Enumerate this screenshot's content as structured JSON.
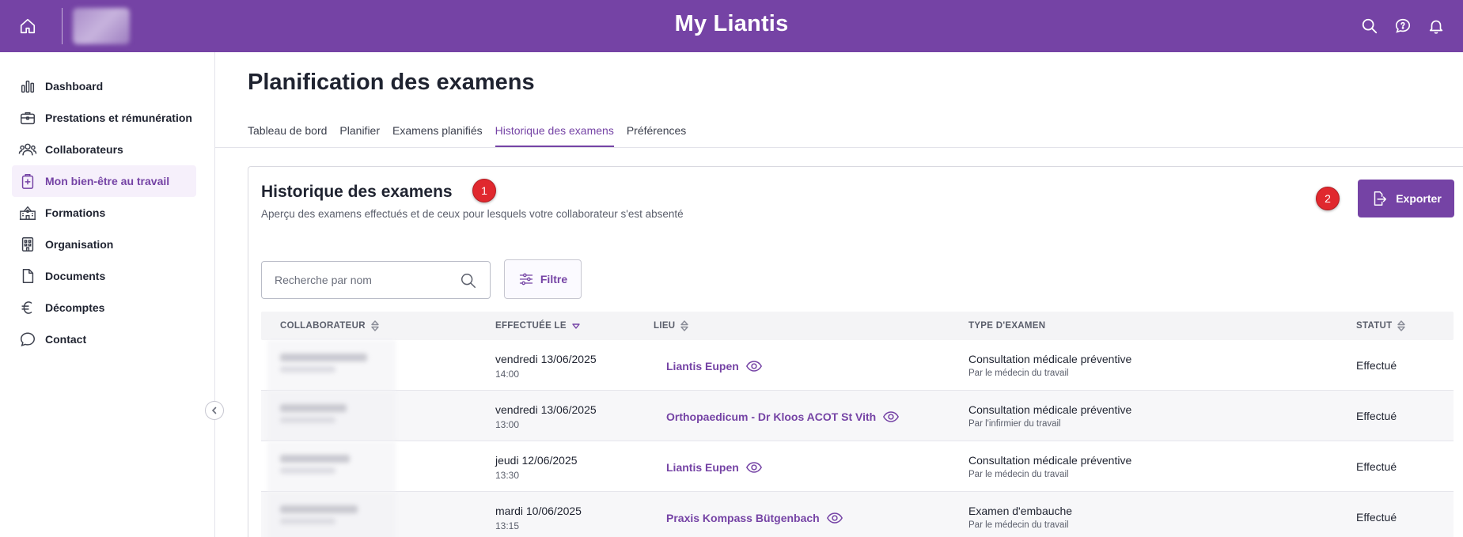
{
  "app": {
    "title": "My Liantis"
  },
  "sidebar": {
    "items": [
      {
        "label": "Dashboard",
        "icon": "bar-chart-icon",
        "active": false
      },
      {
        "label": "Prestations et rémunération",
        "icon": "briefcase-icon",
        "active": false
      },
      {
        "label": "Collaborateurs",
        "icon": "users-icon",
        "active": false
      },
      {
        "label": "Mon bien-être au travail",
        "icon": "medical-badge-icon",
        "active": true
      },
      {
        "label": "Formations",
        "icon": "school-icon",
        "active": false
      },
      {
        "label": "Organisation",
        "icon": "building-icon",
        "active": false
      },
      {
        "label": "Documents",
        "icon": "document-icon",
        "active": false
      },
      {
        "label": "Décomptes",
        "icon": "euro-icon",
        "active": false
      },
      {
        "label": "Contact",
        "icon": "chat-bubble-icon",
        "active": false
      }
    ]
  },
  "page": {
    "title": "Planification des examens",
    "tabs": [
      {
        "label": "Tableau de bord",
        "active": false
      },
      {
        "label": "Planifier",
        "active": false
      },
      {
        "label": "Examens planifiés",
        "active": false
      },
      {
        "label": "Historique des examens",
        "active": true
      },
      {
        "label": "Préférences",
        "active": false
      }
    ]
  },
  "card": {
    "title": "Historique des examens",
    "subtitle": "Aperçu des examens effectués et de ceux pour lesquels votre collaborateur s'est absenté",
    "badge1": "1",
    "badge2": "2",
    "export_label": "Exporter",
    "search_placeholder": "Recherche par nom",
    "filter_label": "Filtre"
  },
  "table": {
    "headers": {
      "collaborateur": "COLLABORATEUR",
      "effectuee": "EFFECTUÉE LE",
      "lieu": "LIEU",
      "type": "TYPE D'EXAMEN",
      "statut": "STATUT"
    },
    "rows": [
      {
        "date": "vendredi 13/06/2025",
        "time": "14:00",
        "lieu": "Liantis Eupen",
        "type": "Consultation médicale préventive",
        "type_sub": "Par le médecin du travail",
        "statut": "Effectué"
      },
      {
        "date": "vendredi 13/06/2025",
        "time": "13:00",
        "lieu": "Orthopaedicum - Dr Kloos ACOT St Vith",
        "type": "Consultation médicale préventive",
        "type_sub": "Par l'infirmier du travail",
        "statut": "Effectué"
      },
      {
        "date": "jeudi 12/06/2025",
        "time": "13:30",
        "lieu": "Liantis Eupen",
        "type": "Consultation médicale préventive",
        "type_sub": "Par le médecin du travail",
        "statut": "Effectué"
      },
      {
        "date": "mardi 10/06/2025",
        "time": "13:15",
        "lieu": "Praxis Kompass Bütgenbach",
        "type": "Examen d'embauche",
        "type_sub": "Par le médecin du travail",
        "statut": "Effectué"
      }
    ]
  },
  "colors": {
    "brand": "#7543a5",
    "badge": "#e0282e"
  }
}
